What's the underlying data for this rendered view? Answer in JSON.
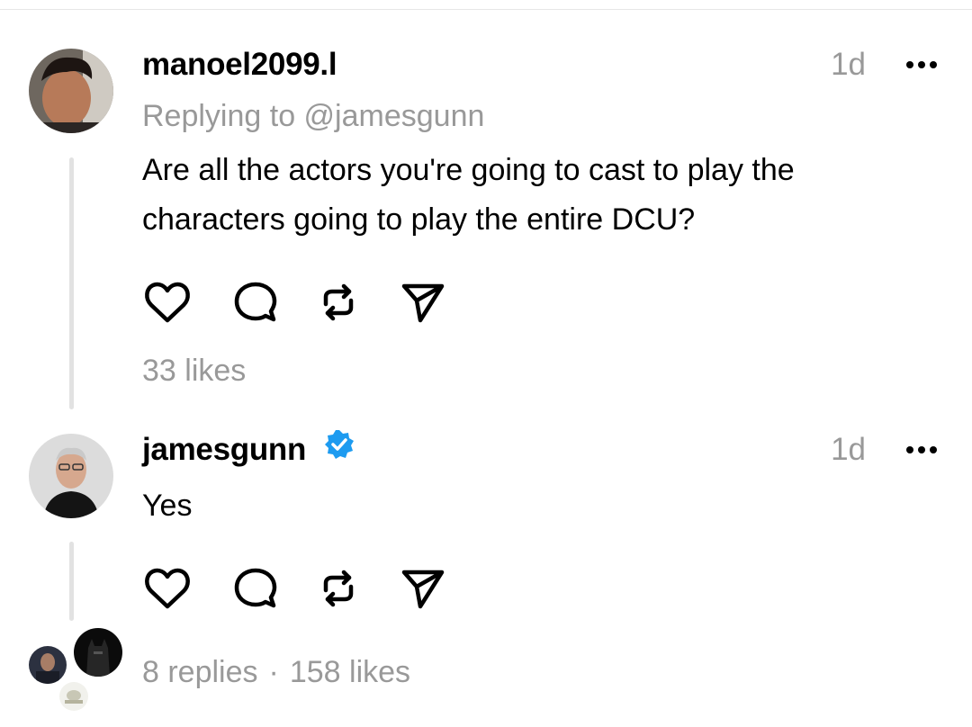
{
  "posts": [
    {
      "username": "manoel2099.l",
      "time": "1d",
      "replying_to": "Replying to @jamesgunn",
      "text": "Are all the actors you're going to cast to play the characters going to play the entire DCU?",
      "likes": "33 likes"
    },
    {
      "username": "jamesgunn",
      "verified": true,
      "time": "1d",
      "text": "Yes",
      "replies": "8 replies",
      "separator": "·",
      "likes": "158 likes"
    }
  ],
  "icons": {
    "like": "heart-icon",
    "comment": "comment-bubble-icon",
    "repost": "repost-icon",
    "share": "send-icon",
    "more": "more-horizontal-icon",
    "verified": "verified-badge-icon"
  },
  "colors": {
    "muted": "#999999",
    "verified": "#1d9bf0",
    "thread_line": "#e2e2e2"
  }
}
